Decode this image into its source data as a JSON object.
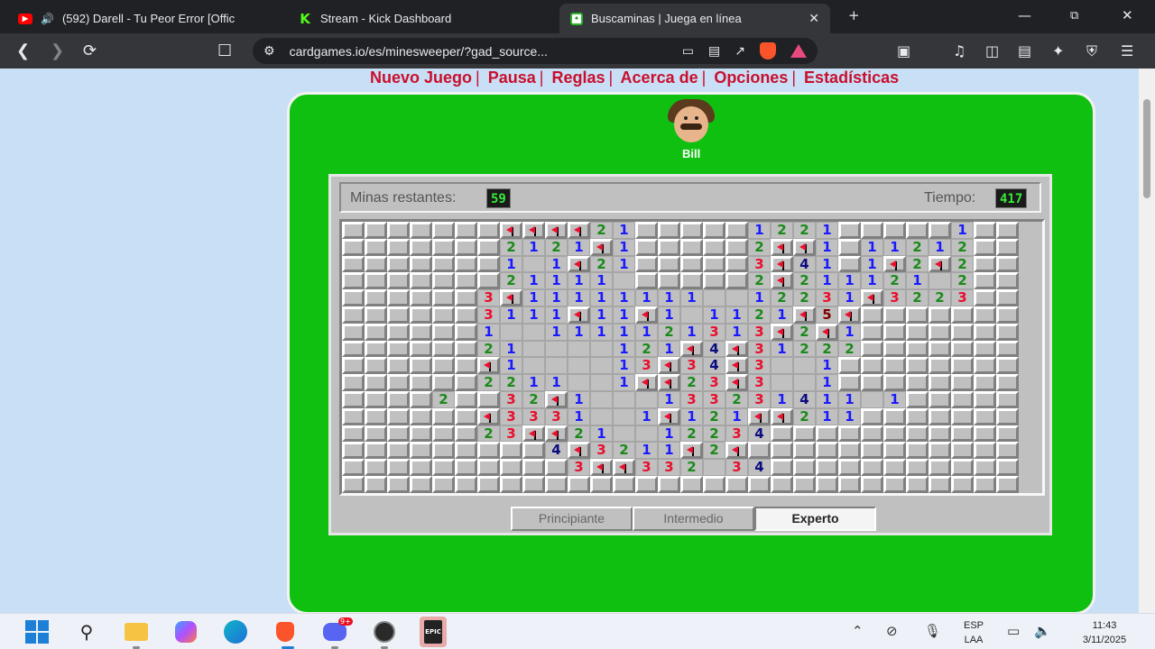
{
  "browser": {
    "tabs": [
      {
        "title": "(592) Darell - Tu Peor Error [Offic",
        "icon": "youtube-icon"
      },
      {
        "title": "Stream - Kick Dashboard",
        "icon": "kick-icon"
      },
      {
        "title": "Buscaminas | Juega en línea",
        "icon": "cardgames-icon"
      }
    ],
    "url": "cardgames.io/es/minesweeper/?gad_source..."
  },
  "game": {
    "menu": [
      "Nuevo Juego",
      "Pausa",
      "Reglas",
      "Acerca de",
      "Opciones",
      "Estadísticas"
    ],
    "player_name": "Bill",
    "mines_label": "Minas restantes:",
    "mines_value": "59",
    "time_label": "Tiempo:",
    "time_value": "417",
    "levels": [
      "Principiante",
      "Intermedio",
      "Experto"
    ],
    "selected_level": "Experto",
    "board_legend": "H=hidden, .=revealed empty, F=flag, digits=adjacent mine count",
    "board": [
      "HHHHHHHFFFF21HHHHH1221HHHHH1HHHH",
      "HHHHHHH2121F1HHHHH2FF1H11212HHHH",
      "HHHHHHH1.1F21HHHHH3F41H1F2F2HHHH",
      "HHHHHHH21111.HHHHH2F211121 2HHHH",
      "HHHHHH3F11111111..12231F3223HHHH",
      "HHHHHH3111F11F1.1121F5FHHHHHHHHH",
      "HHHHHH1..1111121313F2F1HHHHHHHHH",
      "HHHHHH21....121F4F31222HHHHHHHHH",
      "HHHHHHF1....13F34F3..1HHHHHHHHHH",
      "HHHHHH2211..1FF23F3..1HHHHHHHHHH",
      "HHHH2HH32F1...133231411.1HHHHHHHHH",
      "HHHHHHF3331..1F121FF211HHHHHHHHH",
      "HHHHHH23FF21..12234HHHHHHHHHHHHH",
      "HHHHHHHHH4F3211F2FHHHHHHHHHHHHHH",
      "HHHHHHHHHH3FF332 34HHHHHHHHHHHHHH",
      "HHHHHHHHHHHHHHHHHHHHHHHHHHHHHHHH"
    ]
  },
  "taskbar": {
    "lang_line1": "ESP",
    "lang_line2": "LAA",
    "time": "11:43",
    "date": "3/11/2025",
    "discord_badge": "9+"
  }
}
